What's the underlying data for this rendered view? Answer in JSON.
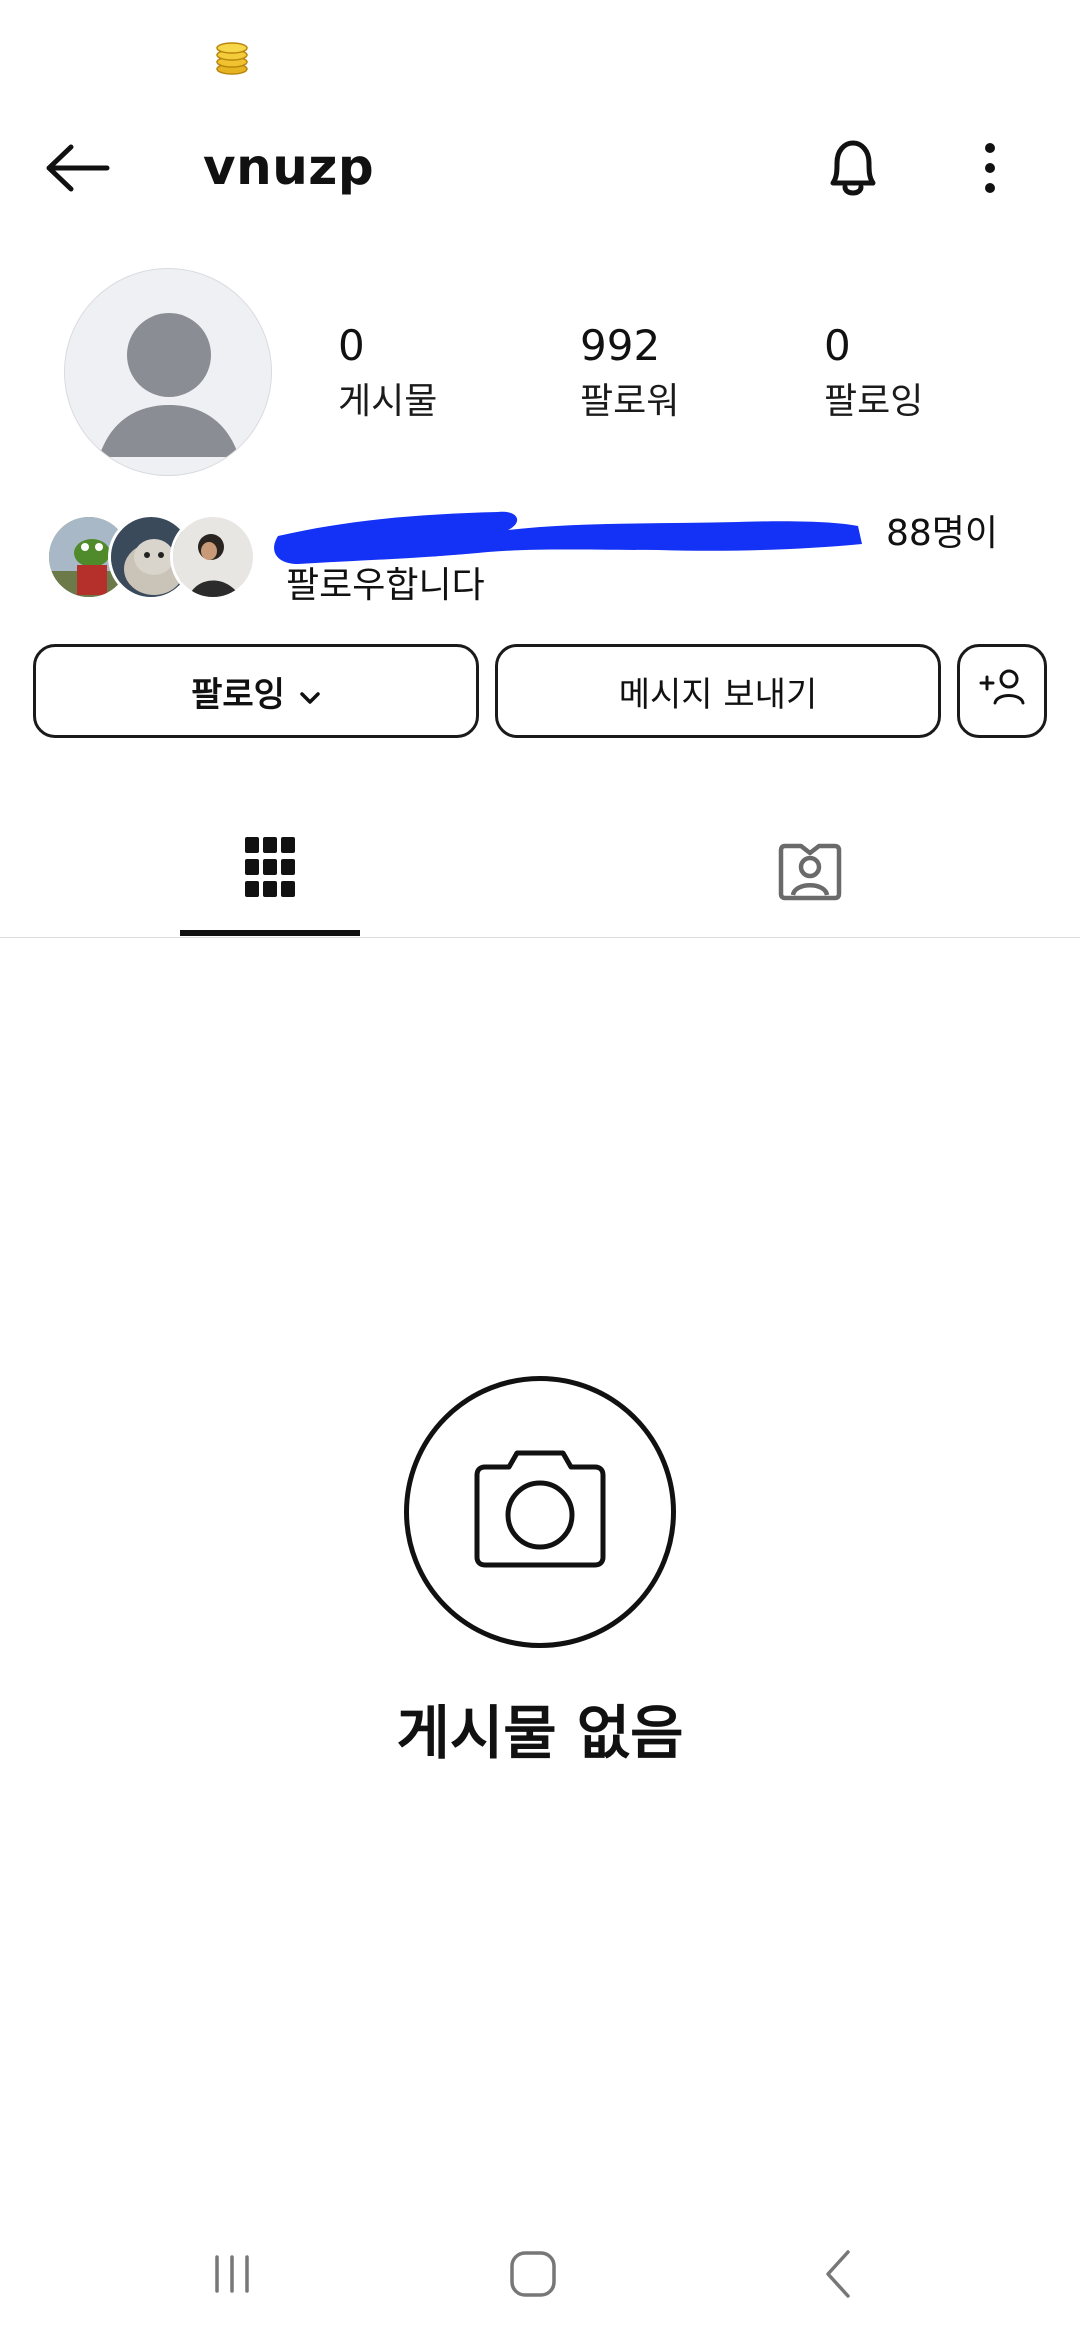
{
  "colors": {
    "text": "#111111",
    "avatar_bg": "#eff0f3",
    "avatar_figure": "#8a8d93",
    "redaction": "#1432f5",
    "divider": "#dcdcdc"
  },
  "status_bar": {
    "icon": "coin-stack-icon"
  },
  "header": {
    "username": "vnuzp",
    "back_icon": "arrow-left-icon",
    "bell_icon": "bell-icon",
    "more_icon": "more-vertical-icon"
  },
  "profile": {
    "avatar_icon": "default-avatar-icon",
    "stats": [
      {
        "value": "0",
        "label": "게시물"
      },
      {
        "value": "992",
        "label": "팔로워"
      },
      {
        "value": "0",
        "label": "팔로잉"
      }
    ],
    "followed_by": {
      "count_text": "88명이",
      "line2": "팔로우합니다"
    }
  },
  "actions": {
    "following_label": "팔로잉",
    "message_label": "메시지 보내기",
    "add_user_icon": "add-user-icon"
  },
  "tabs": [
    {
      "icon": "grid-icon",
      "active": true
    },
    {
      "icon": "tagged-person-icon",
      "active": false
    }
  ],
  "empty_state": {
    "icon": "camera-icon",
    "title": "게시물 없음"
  },
  "nav_bar": {
    "recent_icon": "recent-apps-icon",
    "home_icon": "home-icon",
    "back_icon": "back-icon"
  }
}
